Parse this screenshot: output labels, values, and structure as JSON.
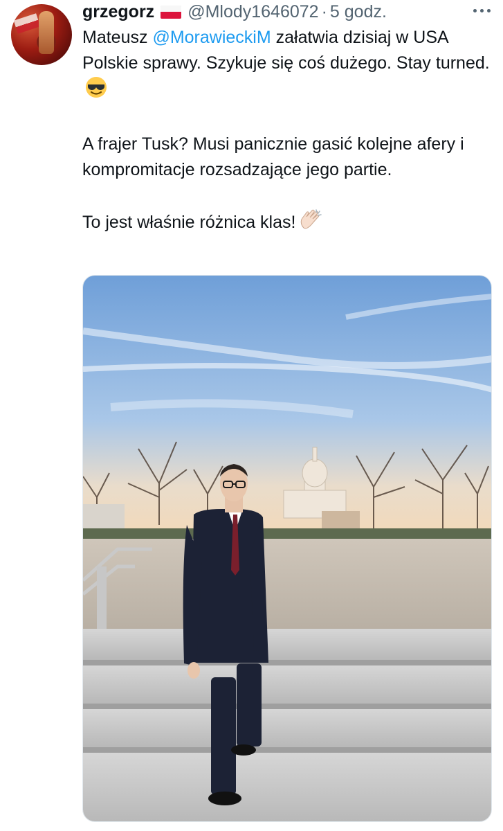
{
  "tweet": {
    "author_name": "grzegorz",
    "author_handle": "@Mlody1646072",
    "separator": "·",
    "timestamp": "5 godz.",
    "more_icon": "more-horizontal-icon",
    "flag_icon": "poland-flag-icon",
    "body": {
      "p1_before": "Mateusz ",
      "mention": "@MorawieckiM",
      "p1_after": " załatwia dzisiaj w USA Polskie sprawy. Szykuje się coś dużego. Stay turned.",
      "p1_emoji": "smiling-face-with-sunglasses-icon",
      "p2": "A frajer Tusk? Musi panicznie gasić kolejne afery i kompromitacje rozsadzające jego partie.",
      "p3": "To jest właśnie różnica klas!",
      "p3_emoji": "clapping-hands-icon"
    },
    "colors": {
      "text": "#0f1419",
      "secondary": "#536471",
      "link": "#1d9bf0",
      "flag_white": "#f7f7f7",
      "flag_red": "#dc143c"
    }
  }
}
